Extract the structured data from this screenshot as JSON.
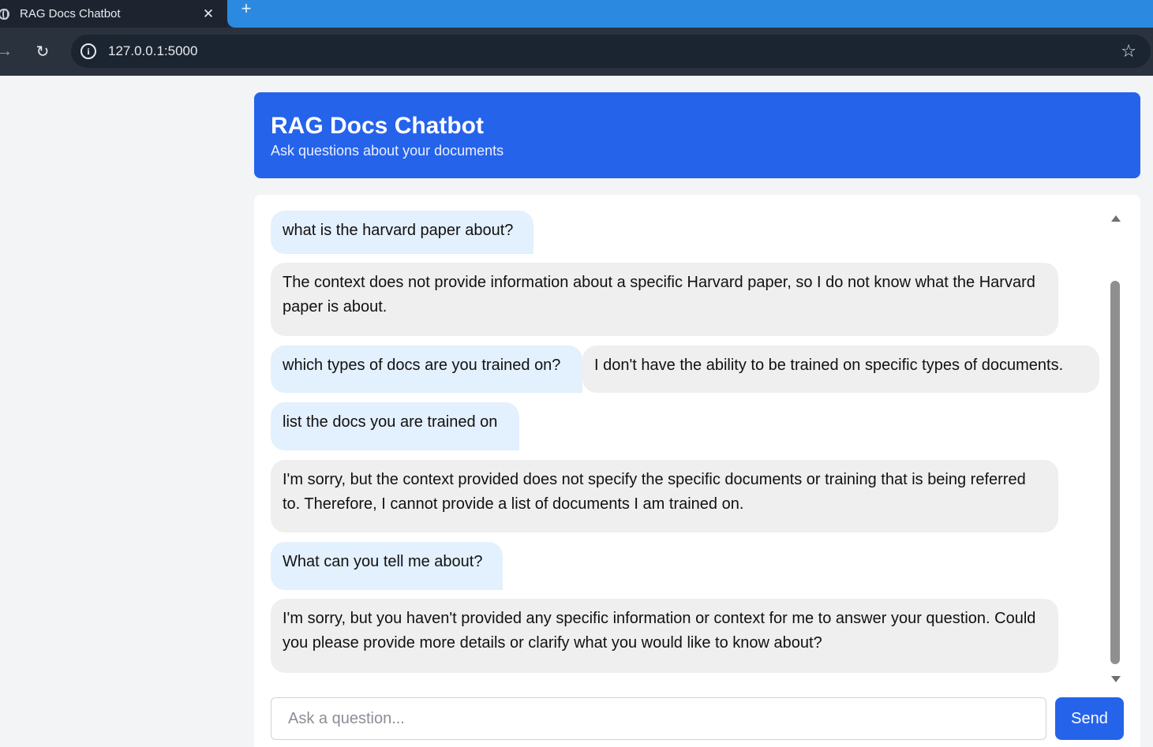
{
  "browser": {
    "tab_title": "RAG Docs Chatbot",
    "tab_close": "✕",
    "new_tab": "+",
    "url": "127.0.0.1:5000"
  },
  "header": {
    "title": "RAG Docs Chatbot",
    "subtitle": "Ask questions about your documents"
  },
  "messages": [
    {
      "role": "user",
      "text": "what is the harvard paper about?"
    },
    {
      "role": "bot",
      "text": "The context does not provide information about a specific Harvard paper, so I do not know what the Harvard paper is about."
    },
    {
      "role": "user",
      "text": "which types of docs are you trained on?"
    },
    {
      "role": "bot",
      "text": "I don't have the ability to be trained on specific types of documents."
    },
    {
      "role": "user",
      "text": "list the docs you are trained on"
    },
    {
      "role": "bot",
      "text": "I'm sorry, but the context provided does not specify the specific documents or training that is being referred to. Therefore, I cannot provide a list of documents I am trained on."
    },
    {
      "role": "user",
      "text": "What can you tell me about?"
    },
    {
      "role": "bot",
      "text": "I'm sorry, but you haven't provided any specific information or context for me to answer your question. Could you please provide more details or clarify what you would like to know about?"
    }
  ],
  "input": {
    "placeholder": "Ask a question...",
    "value": ""
  },
  "send_label": "Send"
}
